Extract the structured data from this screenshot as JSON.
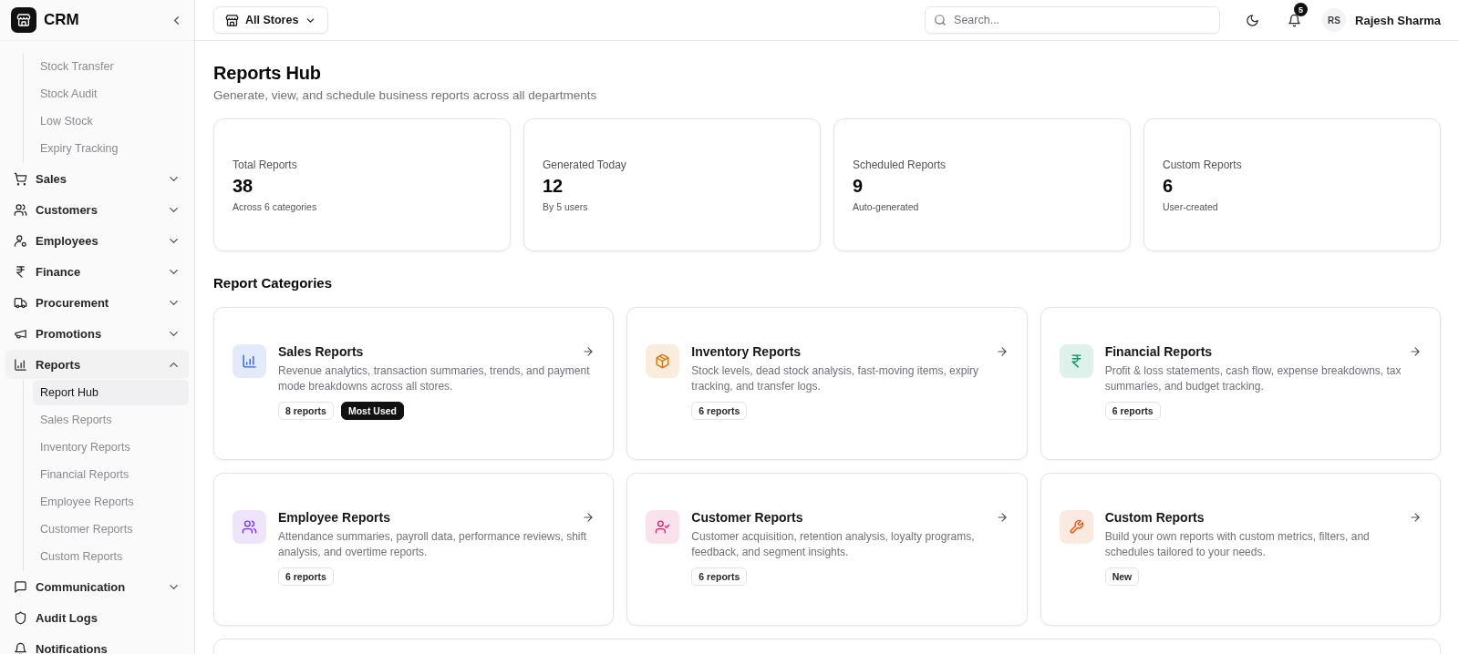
{
  "app": {
    "name": "CRM"
  },
  "sidebar": {
    "open_submenu": [
      {
        "label": "Stock Transfer",
        "selected": false
      },
      {
        "label": "Stock Audit",
        "selected": false
      },
      {
        "label": "Low Stock",
        "selected": false
      },
      {
        "label": "Expiry Tracking",
        "selected": false
      }
    ],
    "items": [
      {
        "label": "Sales",
        "kind": "cart",
        "expanded": false
      },
      {
        "label": "Customers",
        "kind": "users",
        "expanded": false
      },
      {
        "label": "Employees",
        "kind": "person",
        "expanded": false
      },
      {
        "label": "Finance",
        "kind": "rupee",
        "expanded": false
      },
      {
        "label": "Procurement",
        "kind": "truck",
        "expanded": false
      },
      {
        "label": "Promotions",
        "kind": "megaphone",
        "expanded": false
      },
      {
        "label": "Reports",
        "kind": "chart",
        "expanded": true,
        "children": [
          {
            "label": "Report Hub",
            "selected": true
          },
          {
            "label": "Sales Reports",
            "selected": false
          },
          {
            "label": "Inventory Reports",
            "selected": false
          },
          {
            "label": "Financial Reports",
            "selected": false
          },
          {
            "label": "Employee Reports",
            "selected": false
          },
          {
            "label": "Customer Reports",
            "selected": false
          },
          {
            "label": "Custom Reports",
            "selected": false
          }
        ]
      },
      {
        "label": "Communication",
        "kind": "message",
        "expanded": false
      },
      {
        "label": "Audit Logs",
        "kind": "shield"
      },
      {
        "label": "Notifications",
        "kind": "bell"
      }
    ]
  },
  "header": {
    "store_selector": "All Stores",
    "search": {
      "placeholder": "Search..."
    },
    "notification_count": "5",
    "user": {
      "initials": "RS",
      "name": "Rajesh Sharma"
    }
  },
  "page": {
    "title": "Reports Hub",
    "subtitle": "Generate, view, and schedule business reports across all departments"
  },
  "stats": [
    {
      "label": "Total Reports",
      "value": "38",
      "note": "Across 6 categories"
    },
    {
      "label": "Generated Today",
      "value": "12",
      "note": "By 5 users"
    },
    {
      "label": "Scheduled Reports",
      "value": "9",
      "note": "Auto-generated"
    },
    {
      "label": "Custom Reports",
      "value": "6",
      "note": "User-created"
    }
  ],
  "categories_title": "Report Categories",
  "categories": [
    {
      "title": "Sales Reports",
      "kind": "chart",
      "color": "#2563eb",
      "description": "Revenue analytics, transaction summaries, trends, and payment mode breakdowns across all stores.",
      "tags": [
        {
          "text": "8 reports",
          "kind": "outline"
        },
        {
          "text": "Most Used",
          "kind": "solid"
        }
      ]
    },
    {
      "title": "Inventory Reports",
      "kind": "box",
      "color": "#d97706",
      "description": "Stock levels, dead stock analysis, fast-moving items, expiry tracking, and transfer logs.",
      "tags": [
        {
          "text": "6 reports",
          "kind": "outline"
        }
      ]
    },
    {
      "title": "Financial Reports",
      "kind": "rupee",
      "color": "#059669",
      "description": "Profit & loss statements, cash flow, expense breakdowns, tax summaries, and budget tracking.",
      "tags": [
        {
          "text": "6 reports",
          "kind": "outline"
        }
      ]
    },
    {
      "title": "Employee Reports",
      "kind": "users",
      "color": "#7c3aed",
      "description": "Attendance summaries, payroll data, performance reviews, shift analysis, and overtime reports.",
      "tags": [
        {
          "text": "6 reports",
          "kind": "outline"
        }
      ]
    },
    {
      "title": "Customer Reports",
      "kind": "usercheck",
      "color": "#db2777",
      "description": "Customer acquisition, retention analysis, loyalty programs, feedback, and segment insights.",
      "tags": [
        {
          "text": "6 reports",
          "kind": "outline"
        }
      ]
    },
    {
      "title": "Custom Reports",
      "kind": "wrench",
      "color": "#ea580c",
      "description": "Build your own reports with custom metrics, filters, and schedules tailored to your needs.",
      "tags": [
        {
          "text": "New",
          "kind": "outline"
        }
      ]
    }
  ]
}
